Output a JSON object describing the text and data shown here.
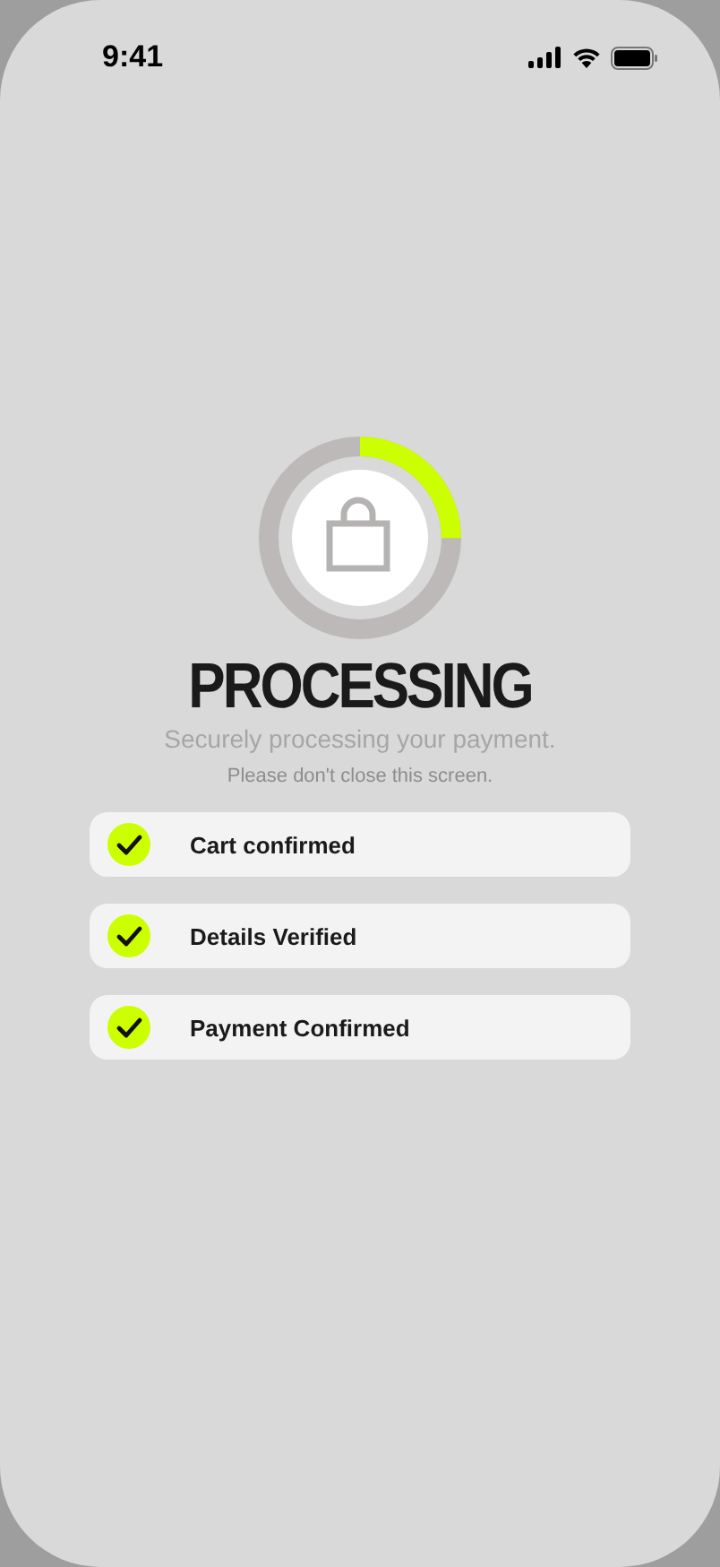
{
  "status_bar": {
    "time": "9:41"
  },
  "progress": {
    "level": 0.25
  },
  "title": "PROCESSING",
  "subtitle": "Securely processing your payment.",
  "note": "Please don't close this screen.",
  "steps": [
    {
      "label": "Cart confirmed",
      "checked": true
    },
    {
      "label": "Details Verified",
      "checked": true
    },
    {
      "label": "Payment Confirmed",
      "checked": true
    }
  ]
}
